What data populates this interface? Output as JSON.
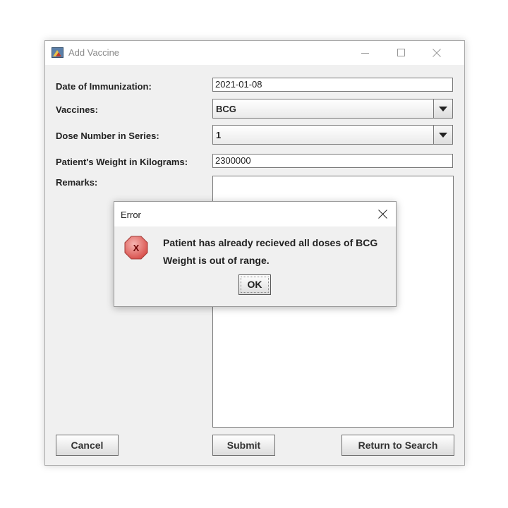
{
  "window": {
    "title": "Add Vaccine",
    "icon": "java-app-icon"
  },
  "form": {
    "date_label": "Date of Immunization:",
    "date_value": "2021-01-08",
    "vaccines_label": "Vaccines:",
    "vaccines_value": "BCG",
    "dose_label": "Dose Number in Series:",
    "dose_value": "1",
    "weight_label": "Patient's Weight in Kilograms:",
    "weight_value": "2300000",
    "remarks_label": "Remarks:",
    "remarks_value": ""
  },
  "buttons": {
    "cancel": "Cancel",
    "submit": "Submit",
    "return_to_search": "Return to Search"
  },
  "dialog": {
    "title": "Error",
    "icon": "error-icon",
    "line1": "Patient has already recieved all doses of BCG",
    "line2": "Weight is out of range.",
    "ok": "OK"
  },
  "colors": {
    "error_icon": "#d9534f",
    "window_bg": "#f0f0f0"
  }
}
